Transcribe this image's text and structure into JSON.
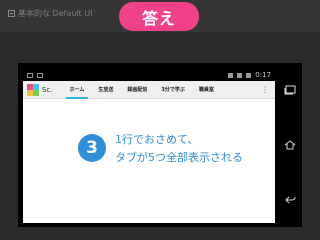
{
  "slide": {
    "title": "基本的な Default UI",
    "badge": "答え"
  },
  "statusbar": {
    "time": "0:17"
  },
  "actionbar": {
    "app_name": "Sc.",
    "tabs": [
      "ホーム",
      "生放送",
      "録画配信",
      "3分で学ぶ",
      "職員室"
    ],
    "overflow": "⋮"
  },
  "content": {
    "number": "3",
    "line1": "1行でおさめて、",
    "line2": "タブが5つ全部表示される"
  },
  "colors": {
    "badge": "#f0418a",
    "accent": "#2f8fd8",
    "tab_indicator": "#33b5e5"
  },
  "icons": {
    "slide_title": "document-icon",
    "nav": [
      "recent-apps-icon",
      "home-icon",
      "back-icon"
    ]
  }
}
